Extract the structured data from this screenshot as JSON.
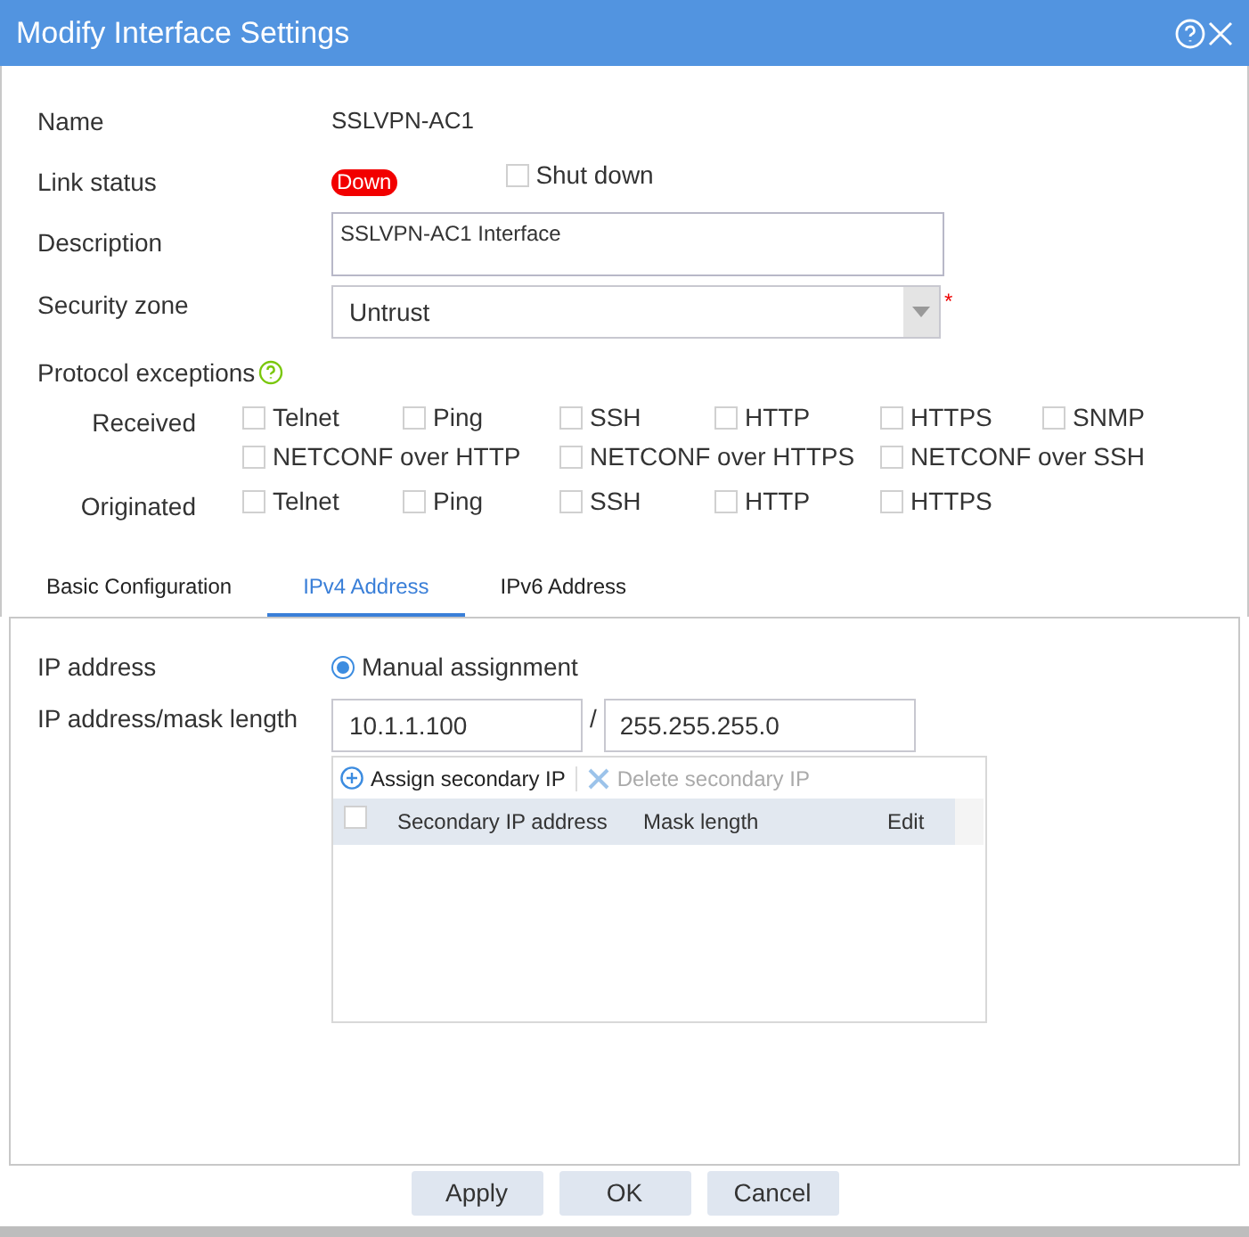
{
  "window": {
    "title": "Modify Interface Settings"
  },
  "fields": {
    "name_label": "Name",
    "name_value": "SSLVPN-AC1",
    "link_label": "Link status",
    "link_status": "Down",
    "shut_down": {
      "label": "Shut down",
      "checked": false
    },
    "description_label": "Description",
    "description_value": "SSLVPN-AC1 Interface",
    "zone_label": "Security zone",
    "zone_value": "Untrust",
    "required_mark": "*"
  },
  "protocol_exceptions": {
    "label": "Protocol exceptions",
    "groups": [
      {
        "label": "Received",
        "lines": [
          [
            {
              "label": "Telnet",
              "checked": false
            },
            {
              "label": "Ping",
              "checked": false
            },
            {
              "label": "SSH",
              "checked": false
            },
            {
              "label": "HTTP",
              "checked": false
            },
            {
              "label": "HTTPS",
              "checked": false
            },
            {
              "label": "SNMP",
              "checked": false
            }
          ],
          [
            {
              "label": "NETCONF over HTTP",
              "checked": false
            },
            {
              "label": "NETCONF over HTTPS",
              "checked": false
            },
            {
              "label": "NETCONF over SSH",
              "checked": false
            }
          ]
        ]
      },
      {
        "label": "Originated",
        "lines": [
          [
            {
              "label": "Telnet",
              "checked": false
            },
            {
              "label": "Ping",
              "checked": false
            },
            {
              "label": "SSH",
              "checked": false
            },
            {
              "label": "HTTP",
              "checked": false
            },
            {
              "label": "HTTPS",
              "checked": false
            }
          ]
        ]
      }
    ]
  },
  "tabs": [
    {
      "label": "Basic Configuration",
      "selected": false
    },
    {
      "label": "IPv4 Address",
      "selected": true
    },
    {
      "label": "IPv6 Address",
      "selected": false
    }
  ],
  "ipv4": {
    "ip_label": "IP address",
    "mode": {
      "label": "Manual assignment",
      "selected": true
    },
    "mask_label": "IP address/mask length",
    "ip_value": "10.1.1.100",
    "separator": "/",
    "mask_value": "255.255.255.0",
    "toolbar": [
      {
        "label": "Assign secondary IP",
        "disabled": false
      },
      {
        "label": "Delete secondary IP",
        "disabled": true
      }
    ],
    "table": {
      "select_all": false,
      "columns": [
        "Secondary IP address",
        "Mask length",
        "Edit"
      ]
    }
  },
  "buttons": [
    "Apply",
    "OK",
    "Cancel"
  ]
}
